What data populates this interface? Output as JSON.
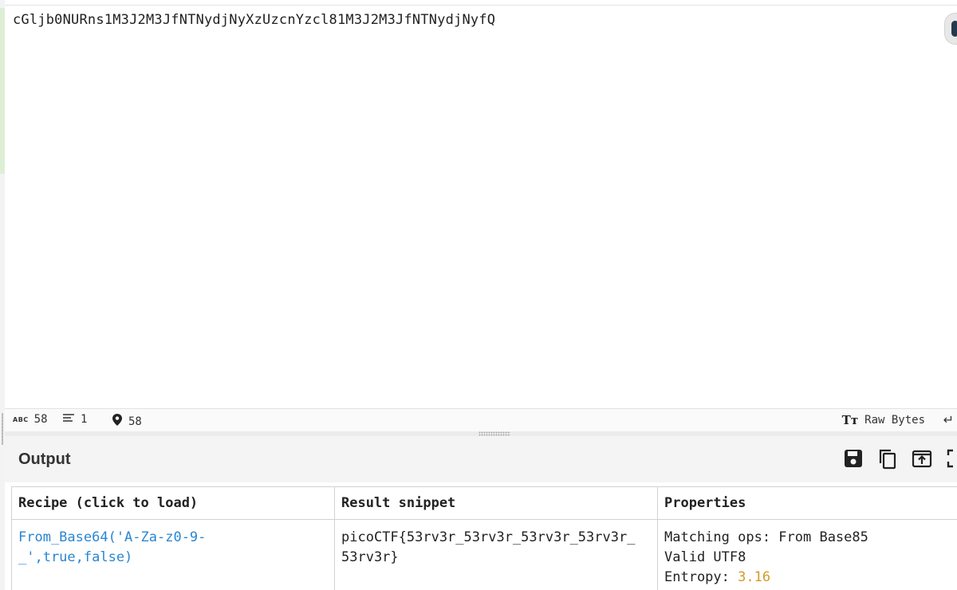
{
  "input": {
    "text": "cGljb0NURns1M3J2M3JfNTNydjNyXzUzcnYzcl81M3J2M3JfNTNydjNyfQ"
  },
  "status": {
    "length": "58",
    "lines": "1",
    "position": "58",
    "raw_bytes_label": "Raw Bytes",
    "icons": [
      "abc-icon",
      "lines-icon",
      "location-pin-icon",
      "text-tt-icon",
      "return-icon"
    ]
  },
  "output": {
    "title": "Output",
    "buttons": [
      "save-icon",
      "copy-icon",
      "replace-input-icon",
      "maximise-icon"
    ]
  },
  "results": {
    "headers": [
      "Recipe (click to load)",
      "Result snippet",
      "Properties"
    ],
    "rows": [
      {
        "recipe_line1": "From_Base64('A-Za-z0-9-",
        "recipe_line2": "_',true,false)",
        "snippet_line1": "picoCTF{53rv3r_53rv3r_53rv3r_53rv3r_",
        "snippet_line2": "53rv3r}",
        "prop_matching": "Matching ops: From Base85",
        "prop_utf8": "Valid UTF8",
        "prop_entropy_label": "Entropy:",
        "prop_entropy_value": "3.16"
      }
    ]
  },
  "colors": {
    "link": "#2a86d1",
    "entropy": "#d29b2a"
  }
}
